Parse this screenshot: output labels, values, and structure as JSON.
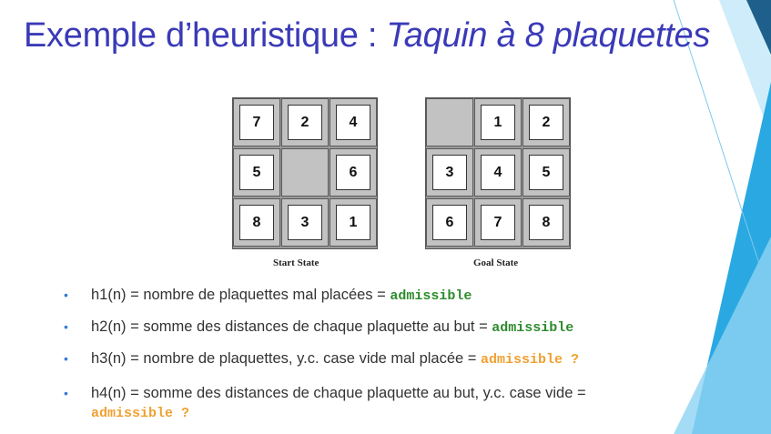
{
  "title": {
    "main": "Exemple d’heuristique : ",
    "italic": "Taquin à 8 plaquettes"
  },
  "start_state": {
    "caption": "Start State",
    "grid": [
      [
        "7",
        "2",
        "4"
      ],
      [
        "5",
        "",
        "6"
      ],
      [
        "8",
        "3",
        "1"
      ]
    ]
  },
  "goal_state": {
    "caption": "Goal State",
    "grid": [
      [
        "",
        "1",
        "2"
      ],
      [
        "3",
        "4",
        "5"
      ],
      [
        "6",
        "7",
        "8"
      ]
    ]
  },
  "bullets": [
    {
      "text": "h1(n) = nombre de plaquettes mal placées = ",
      "tag": "admissible",
      "tag_color": "#2e8b2e"
    },
    {
      "text": "h2(n) = somme des distances de chaque plaquette au but = ",
      "tag": "admissible",
      "tag_color": "#2e8b2e"
    },
    {
      "text": "h3(n) = nombre de plaquettes, y.c. case vide mal placée = ",
      "tag": "admissible ?",
      "tag_color": "#f0a030"
    },
    {
      "text": "h4(n) = somme des distances de chaque plaquette au but, y.c. case vide = ",
      "tag": "admissible ?",
      "tag_color": "#f0a030"
    }
  ],
  "colors": {
    "title": "#3a3ab8",
    "accent_green": "#2e8b2e",
    "accent_orange": "#f0a030",
    "deco_blue": "#29a3e0"
  }
}
